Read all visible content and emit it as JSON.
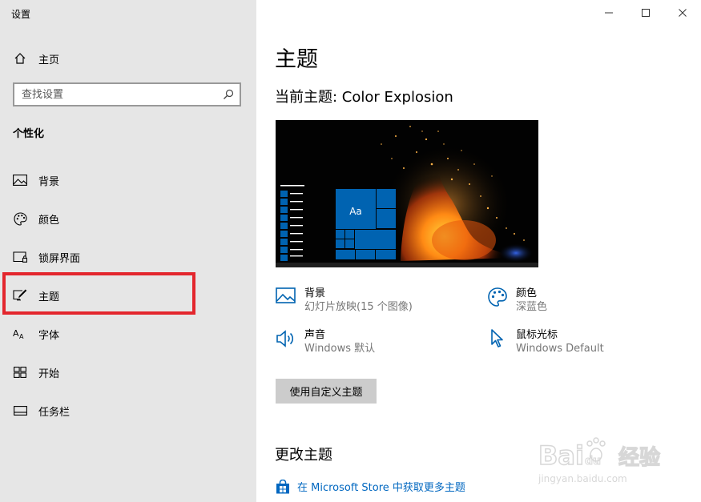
{
  "window": {
    "title": "设置"
  },
  "sidebar": {
    "home": {
      "label": "主页",
      "icon": "home-icon"
    },
    "search": {
      "placeholder": "查找设置",
      "icon": "search-icon"
    },
    "section_title": "个性化",
    "items": [
      {
        "label": "背景",
        "icon": "picture-icon"
      },
      {
        "label": "颜色",
        "icon": "palette-icon"
      },
      {
        "label": "锁屏界面",
        "icon": "lock-screen-icon"
      },
      {
        "label": "主题",
        "icon": "theme-pen-icon",
        "selected": true
      },
      {
        "label": "字体",
        "icon": "font-icon"
      },
      {
        "label": "开始",
        "icon": "start-grid-icon"
      },
      {
        "label": "任务栏",
        "icon": "taskbar-icon"
      }
    ],
    "highlight_color": "#e3262d"
  },
  "main": {
    "title": "主题",
    "current_theme": "当前主题: Color Explosion",
    "preview": {
      "tile_label": "Aa",
      "accent": "#0063b1"
    },
    "properties": {
      "background": {
        "name": "背景",
        "value": "幻灯片放映(15 个图像)",
        "icon": "picture-icon"
      },
      "color": {
        "name": "颜色",
        "value": "深蓝色",
        "icon": "palette-icon"
      },
      "sound": {
        "name": "声音",
        "value": "Windows 默认",
        "icon": "speaker-icon"
      },
      "cursor": {
        "name": "鼠标光标",
        "value": "Windows Default",
        "icon": "cursor-icon"
      }
    },
    "custom_button": "使用自定义主题",
    "change_title": "更改主题",
    "store_link": "在 Microsoft Store 中获取更多主题"
  },
  "watermark": {
    "brand": "Bai",
    "brand2": "du",
    "cn": "经验",
    "url": "jingyan.baidu.com"
  },
  "colors": {
    "sidebar_bg": "#e6e6e6",
    "link": "#0067c0",
    "icon_blue": "#0063b1"
  }
}
